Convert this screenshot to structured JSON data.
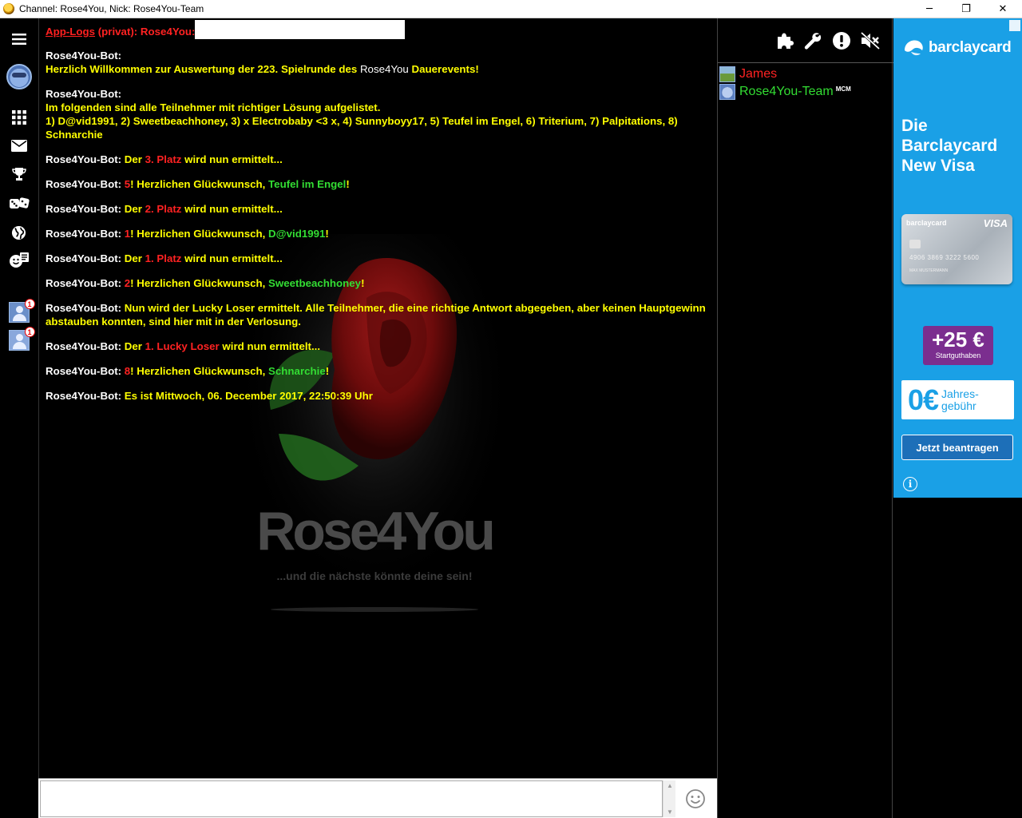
{
  "window": {
    "title": "Channel: Rose4You,  Nick: Rose4You-Team",
    "min_glyph": "─",
    "max_glyph": "❐",
    "close_glyph": "✕"
  },
  "sidebar": {
    "notifications": [
      {
        "badge": "1"
      },
      {
        "badge": "1"
      }
    ]
  },
  "chat": {
    "applog": {
      "label": "App-Logs",
      "rest": " (privat): Rose4You:"
    },
    "messages": [
      {
        "sender": "Rose4You-Bot:",
        "line1_a": "Herzlich Willkommen zur Auswertung der  223. Spielrunde des ",
        "line1_b": "Rose4You",
        "line1_c": " Dauerevents!"
      },
      {
        "sender": "Rose4You-Bot:",
        "line1": "Im folgenden sind alle Teilnehmer mit richtiger Lösung aufgelistet.",
        "line2": "1) D@vid1991, 2) Sweetbeachhoney, 3) x Electrobaby <3 x, 4) Sunnyboyy17, 5) Teufel im Engel, 6) Triterium, 7) Palpitations, 8) Schnarchie"
      },
      {
        "sender": "Rose4You-Bot:",
        "a": " Der ",
        "b": "3. Platz",
        "c": " wird nun ermittelt..."
      },
      {
        "sender": "Rose4You-Bot:",
        "num": " 5",
        "a": "! Herzlichen Glückwunsch, ",
        "name": "Teufel im Engel",
        "c": "!"
      },
      {
        "sender": "Rose4You-Bot:",
        "a": " Der ",
        "b": "2. Platz",
        "c": " wird nun ermittelt..."
      },
      {
        "sender": "Rose4You-Bot:",
        "num": " 1",
        "a": "! Herzlichen Glückwunsch, ",
        "name": "D@vid1991",
        "c": "!"
      },
      {
        "sender": "Rose4You-Bot:",
        "a": " Der ",
        "b": "1. Platz",
        "c": " wird nun ermittelt..."
      },
      {
        "sender": "Rose4You-Bot:",
        "num": " 2",
        "a": "! Herzlichen Glückwunsch, ",
        "name": "Sweetbeachhoney",
        "c": "!"
      },
      {
        "sender": "Rose4You-Bot:",
        "text": " Nun wird der Lucky Loser ermittelt. Alle Teilnehmer, die eine richtige Antwort abgegeben, aber keinen Hauptgewinn abstauben konnten, sind hier mit in der Verlosung."
      },
      {
        "sender": "Rose4You-Bot:",
        "a": " Der ",
        "b": "1. Lucky Loser",
        "c": " wird nun ermittelt..."
      },
      {
        "sender": "Rose4You-Bot:",
        "num": " 8",
        "a": "! Herzlichen Glückwunsch, ",
        "name": "Schnarchie",
        "c": "!"
      },
      {
        "sender": "Rose4You-Bot:",
        "text": " Es ist Mittwoch, 06. December 2017, 22:50:39 Uhr"
      }
    ],
    "background": {
      "brand": "Rose4You",
      "tagline": "...und die nächste könnte deine sein!"
    }
  },
  "userlist": {
    "users": [
      {
        "name": "James",
        "color": "#ff2222",
        "suffix": ""
      },
      {
        "name": "Rose4You-Team",
        "color": "#33dd33",
        "suffix": "MCM"
      }
    ]
  },
  "ad": {
    "brand": "barclaycard",
    "headline": [
      "Die",
      "Barclaycard",
      "New Visa"
    ],
    "card_brand": "barclaycard",
    "card_network": "VISA",
    "card_number": "4906 3869 3222 5600",
    "card_name": "MAX MUSTERMANN",
    "bonus_big": "+25 €",
    "bonus_small": "Startguthaben",
    "fee_big": "0€",
    "fee_small_1": "Jahres-",
    "fee_small_2": "gebühr",
    "cta": "Jetzt beantragen",
    "info": "i",
    "colors": {
      "bg": "#1aa0e6",
      "bonus": "#7b2e8f",
      "cta": "#1d6fb8"
    }
  },
  "input": {
    "value": "",
    "placeholder": ""
  },
  "colors": {
    "chat_bg": "#000000",
    "bot_text": "#ffff00",
    "sender": "#ffffff",
    "highlight_red": "#ff2222",
    "highlight_green": "#33dd33"
  }
}
